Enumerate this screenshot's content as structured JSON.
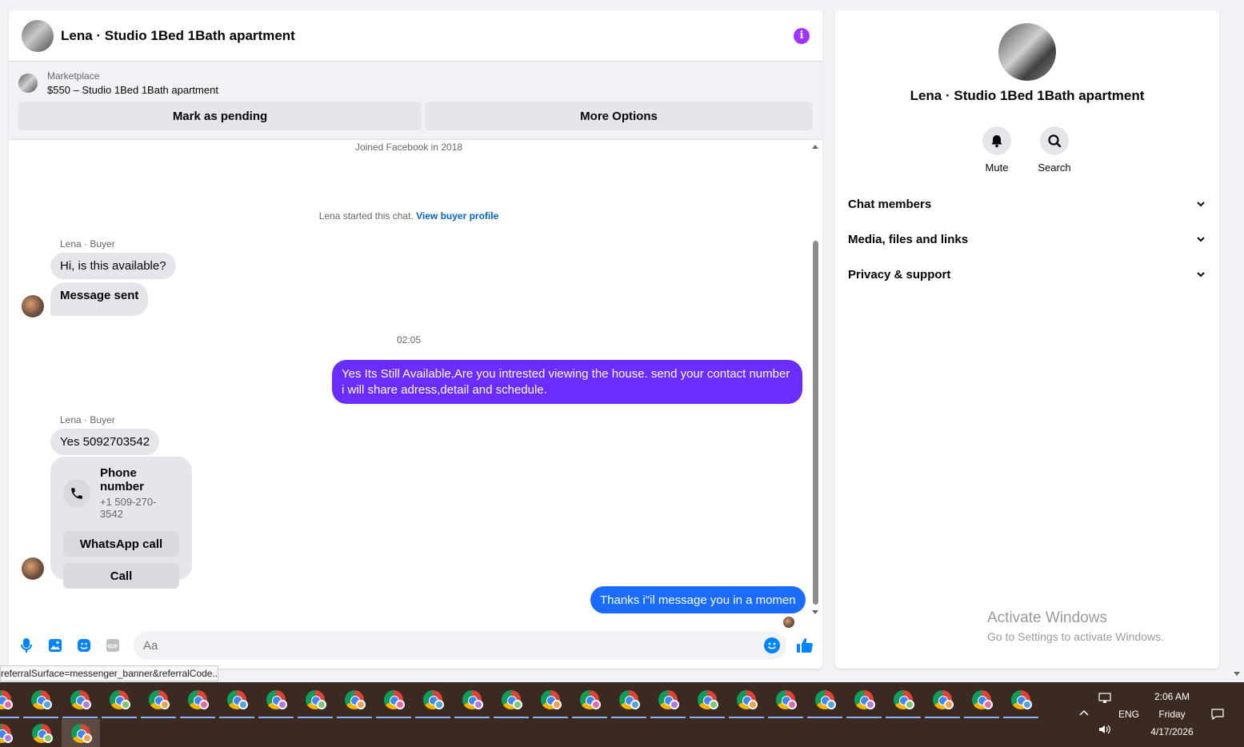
{
  "chat": {
    "title": "Lena · Studio 1Bed 1Bath apartment",
    "marketplace_label": "Marketplace",
    "listing": "$550 – Studio 1Bed 1Bath apartment",
    "mark_pending": "Mark as pending",
    "more_options": "More Options",
    "joined": "Joined Facebook in 2018",
    "started_text": "Lena started this chat.",
    "view_buyer": "View buyer profile",
    "sender_label": "Lena · Buyer",
    "msg1": "Hi, is this available?",
    "msg2": "Message sent",
    "time": "02:05",
    "out1": "Yes Its Still Available,Are you intrested viewing the house. send your contact number i will share adress,detail and schedule.",
    "msg3": "Yes 5092703542",
    "phone_title": "Phone number",
    "phone_number": "+1 509-270-3542",
    "whatsapp": "WhatsApp call",
    "call": "Call",
    "out2": "Thanks i\"il message you in a momen",
    "input_placeholder": "Aa",
    "status_url": "referralSurface=messenger_banner&referralCode..."
  },
  "info": {
    "title": "Lena · Studio 1Bed 1Bath apartment",
    "mute": "Mute",
    "search": "Search",
    "sections": [
      "Chat members",
      "Media, files and links",
      "Privacy & support"
    ]
  },
  "watermark": {
    "line1": "Activate Windows",
    "line2": "Go to Settings to activate Windows."
  },
  "taskbar": {
    "lang": "ENG",
    "time": "2:06 AM",
    "day": "Friday",
    "date": "4/17/2026"
  },
  "colors": {
    "outgoing_purple": "#6a2cff",
    "outgoing_blue": "#1a6cff",
    "accent": "#0084ff",
    "info_icon": "#a033ff"
  }
}
